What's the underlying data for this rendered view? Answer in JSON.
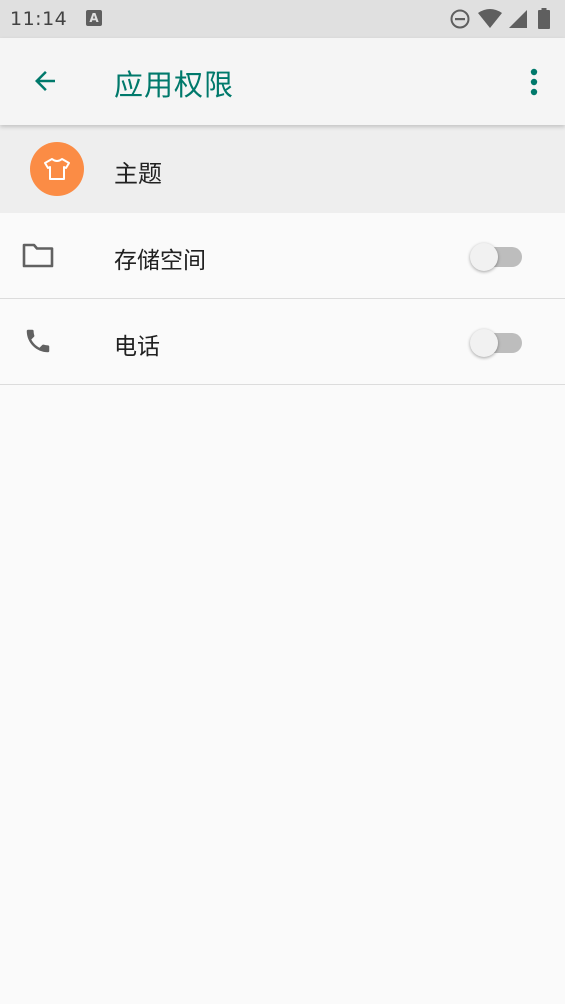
{
  "status_bar": {
    "time": "11:14",
    "notification_glyph": "A",
    "icons": [
      "do-not-disturb-icon",
      "wifi-icon",
      "cell-signal-icon",
      "battery-icon"
    ]
  },
  "app_bar": {
    "title": "应用权限",
    "back_icon": "arrow-back-icon",
    "more_icon": "more-vert-icon",
    "accent_color": "#00796b"
  },
  "app_header": {
    "name": "主题",
    "icon": "t-shirt-icon",
    "icon_bg_color": "#fb8c45"
  },
  "permissions": [
    {
      "label": "存储空间",
      "icon": "folder-icon",
      "enabled": false
    },
    {
      "label": "电话",
      "icon": "phone-icon",
      "enabled": false
    }
  ]
}
